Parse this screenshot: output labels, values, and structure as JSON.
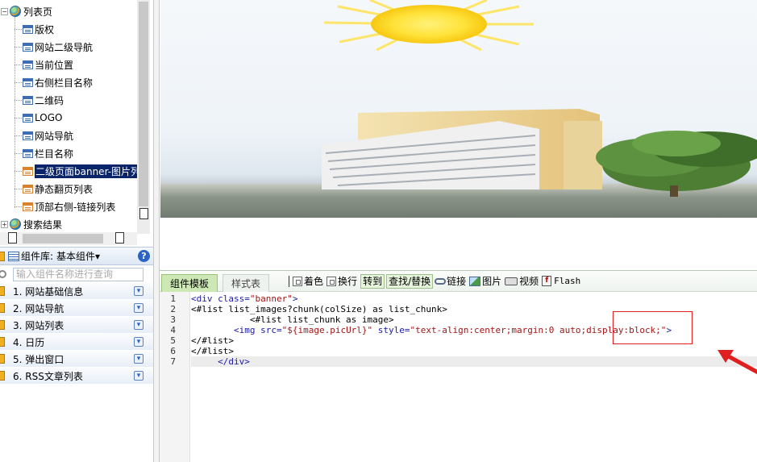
{
  "tree": {
    "root_label": "列表页",
    "items": [
      {
        "label": "版权",
        "icon": "doc-blue"
      },
      {
        "label": "网站二级导航",
        "icon": "doc-blue"
      },
      {
        "label": "当前位置",
        "icon": "doc-blue"
      },
      {
        "label": "右侧栏目名称",
        "icon": "doc-blue"
      },
      {
        "label": "二维码",
        "icon": "doc-blue"
      },
      {
        "label": "LOGO",
        "icon": "doc-blue"
      },
      {
        "label": "网站导航",
        "icon": "doc-blue"
      },
      {
        "label": "栏目名称",
        "icon": "doc-blue"
      },
      {
        "label": "二级页面banner-图片列",
        "icon": "doc-orange",
        "selected": true
      },
      {
        "label": "静态翻页列表",
        "icon": "doc-orange"
      },
      {
        "label": "顶部右侧-链接列表",
        "icon": "doc-orange"
      }
    ],
    "second_root_label": "搜索结果"
  },
  "library": {
    "title": "组件库:",
    "dropdown_value": "基本组件▾",
    "help_label": "?",
    "search_placeholder": "输入组件名称进行查询",
    "categories": [
      {
        "label": "1. 网站基础信息"
      },
      {
        "label": "2. 网站导航"
      },
      {
        "label": "3. 网站列表"
      },
      {
        "label": "4. 日历"
      },
      {
        "label": "5. 弹出窗口"
      },
      {
        "label": "6. RSS文章列表"
      }
    ]
  },
  "toolbar": {
    "tab_active": "组件模板",
    "tab_inactive": "样式表",
    "color_label": "着色",
    "wrap_label": "换行",
    "goto_label": "转到",
    "find_label": "查找/替换",
    "link_label": "链接",
    "image_label": "图片",
    "video_label": "视频",
    "flash_label": "Flash"
  },
  "editor": {
    "line_numbers": [
      "1",
      "2",
      "3",
      "4",
      "5",
      "6",
      "7"
    ],
    "lines": [
      [
        {
          "t": "tag",
          "v": "<div "
        },
        {
          "t": "attr",
          "v": "class="
        },
        {
          "t": "str",
          "v": "\"banner\""
        },
        {
          "t": "tag",
          "v": ">"
        }
      ],
      [
        {
          "t": "plain",
          "v": "<#list list_images?chunk(colSize) as list_chunk>"
        }
      ],
      [
        {
          "t": "plain",
          "v": "           <#list list_chunk as image>"
        }
      ],
      [
        {
          "t": "tag",
          "v": "        <img "
        },
        {
          "t": "attr",
          "v": "src="
        },
        {
          "t": "str",
          "v": "\"${image.picUrl}\""
        },
        {
          "t": "attr",
          "v": " style="
        },
        {
          "t": "str",
          "v": "\"text-align:center;margin:0 auto;display:block;\""
        },
        {
          "t": "tag",
          "v": ">"
        }
      ],
      [
        {
          "t": "plain",
          "v": "</#list>"
        }
      ],
      [
        {
          "t": "plain",
          "v": "</#list>"
        }
      ],
      [
        {
          "t": "tag",
          "v": "     </div>"
        }
      ]
    ]
  },
  "colors": {
    "selection": "#0a246a",
    "tab_active_bg": "#cde8b5",
    "annotation_red": "#e02020",
    "tag_blue": "#1a1aa6",
    "string_red": "#a31515"
  }
}
